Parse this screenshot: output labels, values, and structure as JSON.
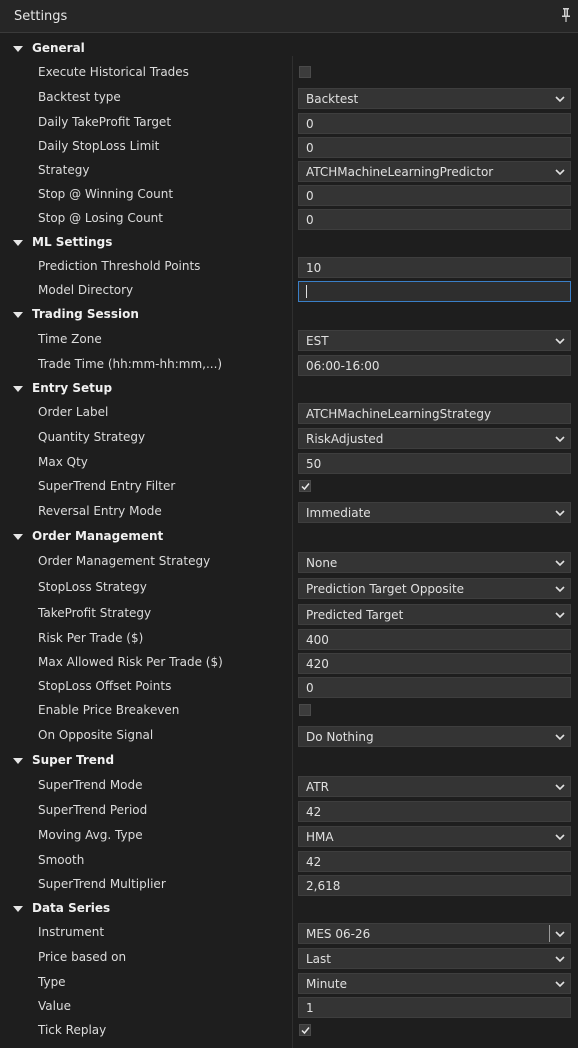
{
  "window": {
    "title": "Settings"
  },
  "categories": {
    "general": "General",
    "ml": "ML Settings",
    "trading": "Trading Session",
    "entry": "Entry Setup",
    "order": "Order Management",
    "supertrend": "Super Trend",
    "dataseries": "Data Series"
  },
  "labels": {
    "execute_historical": "Execute Historical Trades",
    "backtest_type": "Backtest type",
    "daily_tp": "Daily TakeProfit Target",
    "daily_sl": "Daily StopLoss Limit",
    "strategy": "Strategy",
    "stop_win": "Stop @ Winning Count",
    "stop_lose": "Stop @ Losing Count",
    "pred_threshold": "Prediction Threshold Points",
    "model_dir": "Model Directory",
    "time_zone": "Time Zone",
    "trade_time": "Trade Time (hh:mm-hh:mm,...)",
    "order_label": "Order Label",
    "qty_strategy": "Quantity Strategy",
    "max_qty": "Max Qty",
    "st_entry_filter": "SuperTrend Entry Filter",
    "reversal_mode": "Reversal Entry Mode",
    "om_strategy": "Order Management Strategy",
    "sl_strategy": "StopLoss Strategy",
    "tp_strategy": "TakeProfit Strategy",
    "risk_per_trade": "Risk Per Trade ($)",
    "max_risk": "Max Allowed Risk Per Trade ($)",
    "sl_offset": "StopLoss Offset Points",
    "price_breakeven": "Enable Price Breakeven",
    "opposite_signal": "On Opposite Signal",
    "st_mode": "SuperTrend Mode",
    "st_period": "SuperTrend Period",
    "ma_type": "Moving Avg. Type",
    "smooth": "Smooth",
    "st_multiplier": "SuperTrend Multiplier",
    "instrument": "Instrument",
    "price_based_on": "Price based on",
    "type": "Type",
    "value": "Value",
    "tick_replay": "Tick Replay"
  },
  "values": {
    "execute_historical": false,
    "backtest_type": "Backtest",
    "daily_tp": "0",
    "daily_sl": "0",
    "strategy": "ATCHMachineLearningPredictor",
    "stop_win": "0",
    "stop_lose": "0",
    "pred_threshold": "10",
    "model_dir": "",
    "time_zone": "EST",
    "trade_time": "06:00-16:00",
    "order_label": "ATCHMachineLearningStrategy",
    "qty_strategy": "RiskAdjusted",
    "max_qty": "50",
    "st_entry_filter": true,
    "reversal_mode": "Immediate",
    "om_strategy": "None",
    "sl_strategy": "Prediction Target Opposite",
    "tp_strategy": "Predicted Target",
    "risk_per_trade": "400",
    "max_risk": "420",
    "sl_offset": "0",
    "price_breakeven": false,
    "opposite_signal": "Do Nothing",
    "st_mode": "ATR",
    "st_period": "42",
    "ma_type": "HMA",
    "smooth": "42",
    "st_multiplier": "2,618",
    "instrument": "MES 06-26",
    "price_based_on": "Last",
    "type": "Minute",
    "value": "1",
    "tick_replay": true
  },
  "colors": {
    "background": "#1e1e1e",
    "field": "#343434",
    "focus": "#3a7fc7"
  },
  "icons": {
    "pin": "pin-icon",
    "expand": "chevron-down-icon",
    "collapse": "triangle-down-icon"
  }
}
